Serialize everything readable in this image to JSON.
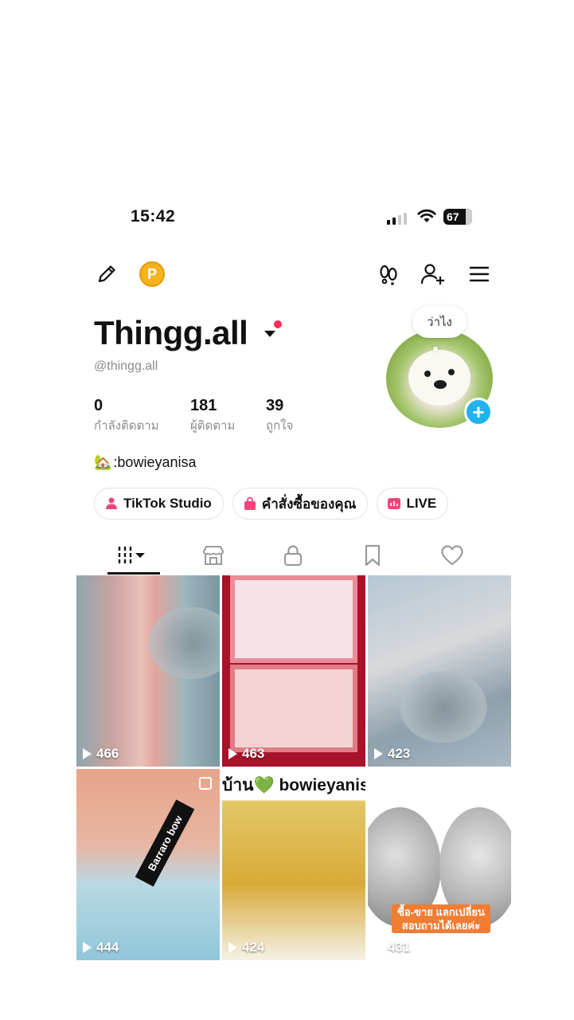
{
  "status": {
    "time": "15:42",
    "battery": "67"
  },
  "profile": {
    "username": "Thingg.all",
    "handle": "@thingg.all",
    "avatar_bubble": "ว่าไง",
    "bio": ":bowieyanisa",
    "bio_emoji": "🏡"
  },
  "stats": [
    {
      "num": "0",
      "label": "กำลังติดตาม"
    },
    {
      "num": "181",
      "label": "ผู้ติดตาม"
    },
    {
      "num": "39",
      "label": "ถูกใจ"
    }
  ],
  "pills": [
    {
      "label": "TikTok Studio"
    },
    {
      "label": "คำสั่งซื้อของคุณ"
    },
    {
      "label": "LIVE"
    }
  ],
  "coin_label": "P",
  "videos": [
    {
      "views": "466"
    },
    {
      "views": "463"
    },
    {
      "views": "423"
    },
    {
      "views": "444",
      "sticker": "Barraro bow"
    },
    {
      "views": "424",
      "header": "บ้าน💚 bowieyanisa"
    },
    {
      "views": "431",
      "tag": "ซื้อ-ขาย แลกเปลี่ยน สอบถามได้เลยค่ะ"
    }
  ],
  "colors": {
    "accent_red": "#fe2c55",
    "accent_blue": "#20b3f0",
    "coin": "#f6b31e"
  }
}
